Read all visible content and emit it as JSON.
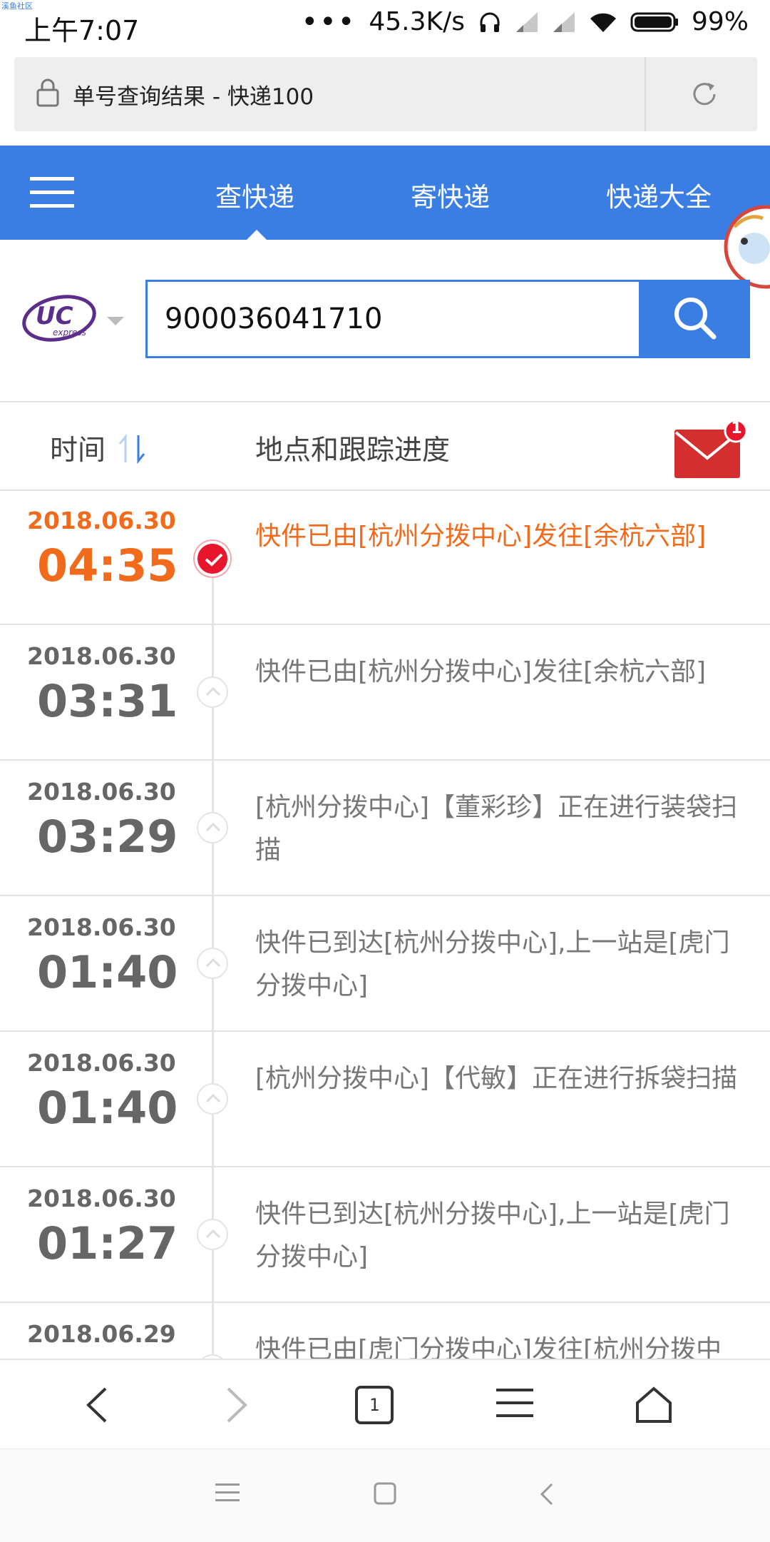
{
  "status_bar": {
    "watermark": "溪鱼社区",
    "time": "上午7:07",
    "network_speed": "45.3K/s",
    "battery": "99%"
  },
  "address_bar": {
    "page_title": "单号查询结果 - 快递100"
  },
  "nav": {
    "tabs": [
      {
        "label": "查快递",
        "active": true
      },
      {
        "label": "寄快递",
        "active": false
      },
      {
        "label": "快递大全",
        "active": false
      }
    ]
  },
  "search": {
    "carrier_logo": "UC express",
    "tracking_number": "900036041710"
  },
  "list_header": {
    "time_label": "时间",
    "location_label": "地点和跟踪进度",
    "mail_badge": "1"
  },
  "timeline": [
    {
      "date": "2018.06.30",
      "time": "04:35",
      "text": "快件已由[杭州分拨中心]发往[余杭六部]",
      "current": true
    },
    {
      "date": "2018.06.30",
      "time": "03:31",
      "text": "快件已由[杭州分拨中心]发往[余杭六部]",
      "current": false
    },
    {
      "date": "2018.06.30",
      "time": "03:29",
      "text": "[杭州分拨中心]【董彩珍】正在进行装袋扫描",
      "current": false
    },
    {
      "date": "2018.06.30",
      "time": "01:40",
      "text": "快件已到达[杭州分拨中心],上一站是[虎门分拨中心]",
      "current": false
    },
    {
      "date": "2018.06.30",
      "time": "01:40",
      "text": "[杭州分拨中心]【代敏】正在进行拆袋扫描",
      "current": false
    },
    {
      "date": "2018.06.30",
      "time": "01:27",
      "text": "快件已到达[杭州分拨中心],上一站是[虎门分拨中心]",
      "current": false
    },
    {
      "date": "2018.06.29",
      "time": "",
      "text": "快件已由[虎门分拨中心]发往[杭州分拨中",
      "current": false
    }
  ],
  "toolbar": {
    "tab_count": "1"
  },
  "colors": {
    "accent": "#3a7ee4",
    "current": "#f26b1d",
    "dot_current": "#e8162c"
  }
}
